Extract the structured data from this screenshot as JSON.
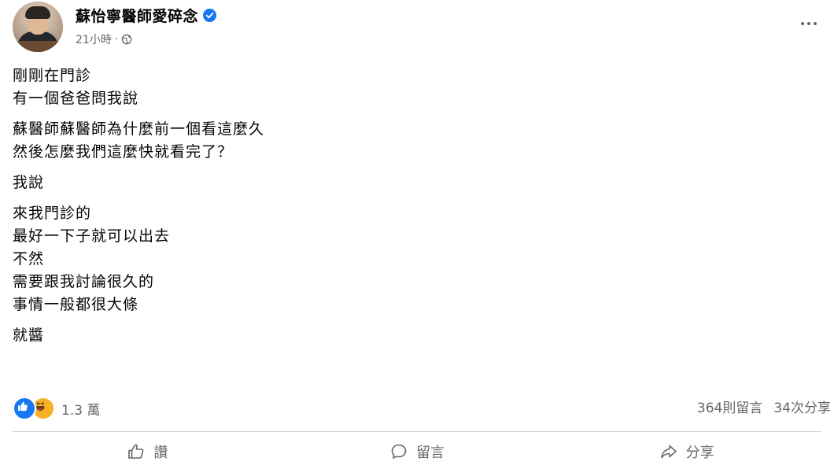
{
  "post": {
    "page_name": "蘇怡寧醫師愛碎念",
    "verified_icon": "verified-badge-icon",
    "timestamp": "21小時",
    "separator": "·",
    "privacy_icon": "globe-icon",
    "more_icon": "more-options-icon"
  },
  "content": {
    "paragraphs": [
      [
        "剛剛在門診",
        "有一個爸爸問我說"
      ],
      [
        "蘇醫師蘇醫師為什麼前一個看這麼久",
        "然後怎麼我們這麼快就看完了？"
      ],
      [
        "我說"
      ],
      [
        "來我門診的",
        "最好一下子就可以出去",
        "不然",
        "需要跟我討論很久的",
        "事情一般都很大條"
      ],
      [
        "就醬"
      ]
    ]
  },
  "stats": {
    "reaction_icons": [
      "like-reaction-icon",
      "haha-reaction-icon"
    ],
    "reaction_count": "1.3 萬",
    "comments": "364則留言",
    "shares": "34次分享"
  },
  "actions": {
    "like_label": "讚",
    "comment_label": "留言",
    "share_label": "分享"
  },
  "colors": {
    "brand_blue": "#1877f2",
    "haha_yellow": "#f7b125",
    "secondary_text": "#65676b"
  }
}
